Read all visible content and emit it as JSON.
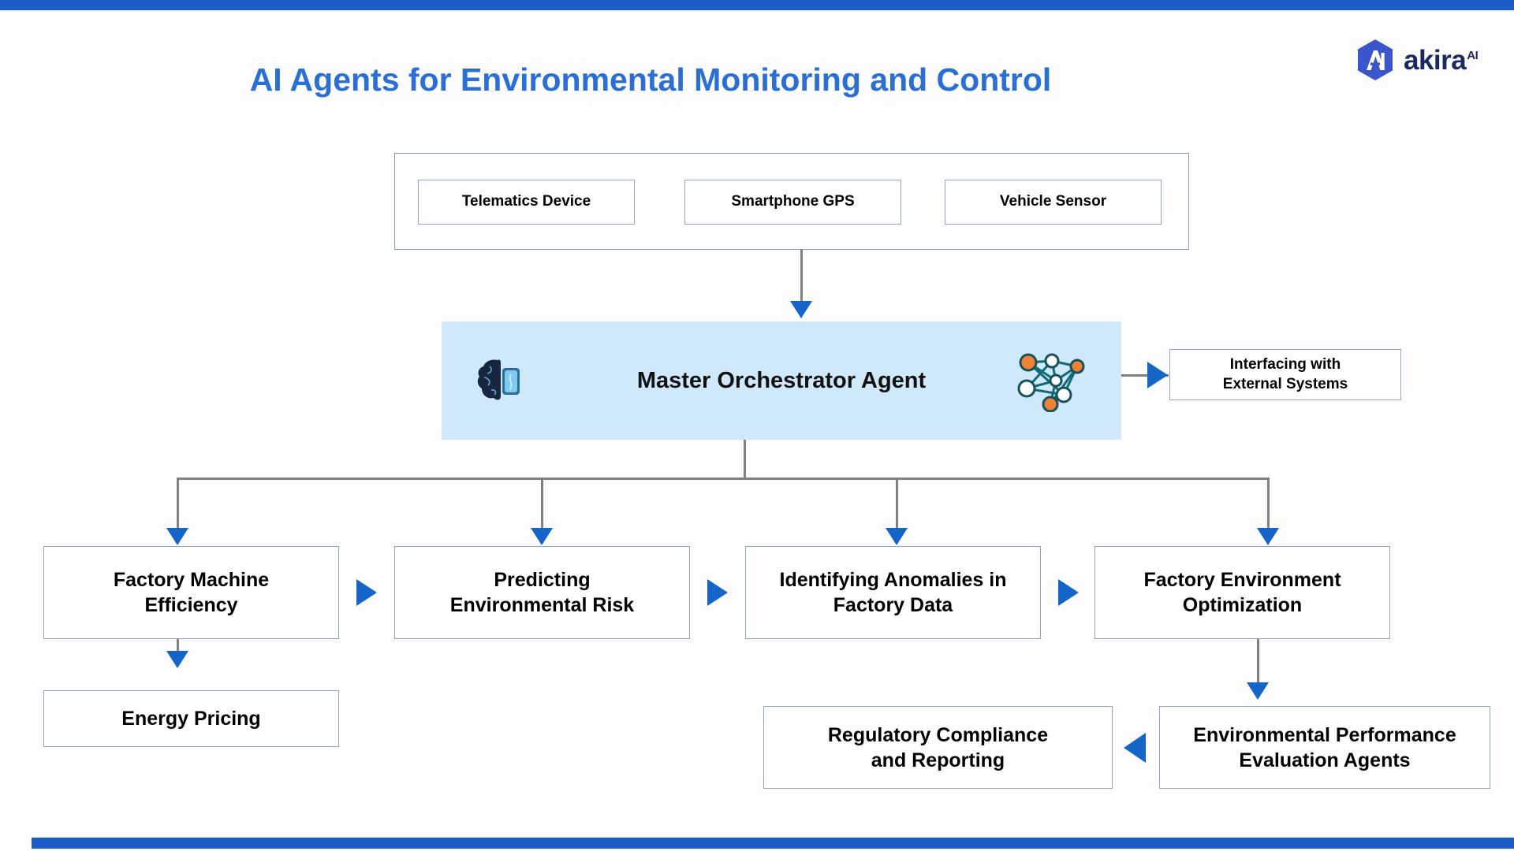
{
  "theme": {
    "accent_blue": "#2a6fd6",
    "bar_blue": "#1b5cc8",
    "arrow_blue": "#1565c9",
    "orchestrator_fill": "#cfe8fa",
    "box_border": "#8ba8c4",
    "connector_gray": "#7f7f7f"
  },
  "brand": {
    "name": "akira",
    "superscript": "AI",
    "logo_icon": "akira-hexagon-logo"
  },
  "header": {
    "title": "AI Agents for Environmental Monitoring and Control"
  },
  "diagram": {
    "sources_group": {
      "name": "data-sources-group",
      "items": [
        {
          "label": "Telematics Device"
        },
        {
          "label": "Smartphone GPS"
        },
        {
          "label": "Vehicle Sensor"
        }
      ]
    },
    "orchestrator": {
      "label": "Master Orchestrator Agent",
      "left_icon": "brain-device-icon",
      "right_icon": "neural-network-icon"
    },
    "external": {
      "label": "Interfacing with External Systems",
      "line1": "Interfacing with",
      "line2": "External Systems"
    },
    "agents": [
      {
        "line1": "Factory Machine",
        "line2": "Efficiency"
      },
      {
        "line1": "Predicting",
        "line2": "Environmental Risk"
      },
      {
        "line1": "Identifying Anomalies in",
        "line2": "Factory Data"
      },
      {
        "line1": "Factory Environment",
        "line2": "Optimization"
      }
    ],
    "bottom": {
      "energy_pricing": "Energy Pricing",
      "regulatory": {
        "line1": "Regulatory Compliance",
        "line2": "and Reporting"
      },
      "evaluation": {
        "line1": "Environmental Performance",
        "line2": "Evaluation Agents"
      }
    }
  }
}
